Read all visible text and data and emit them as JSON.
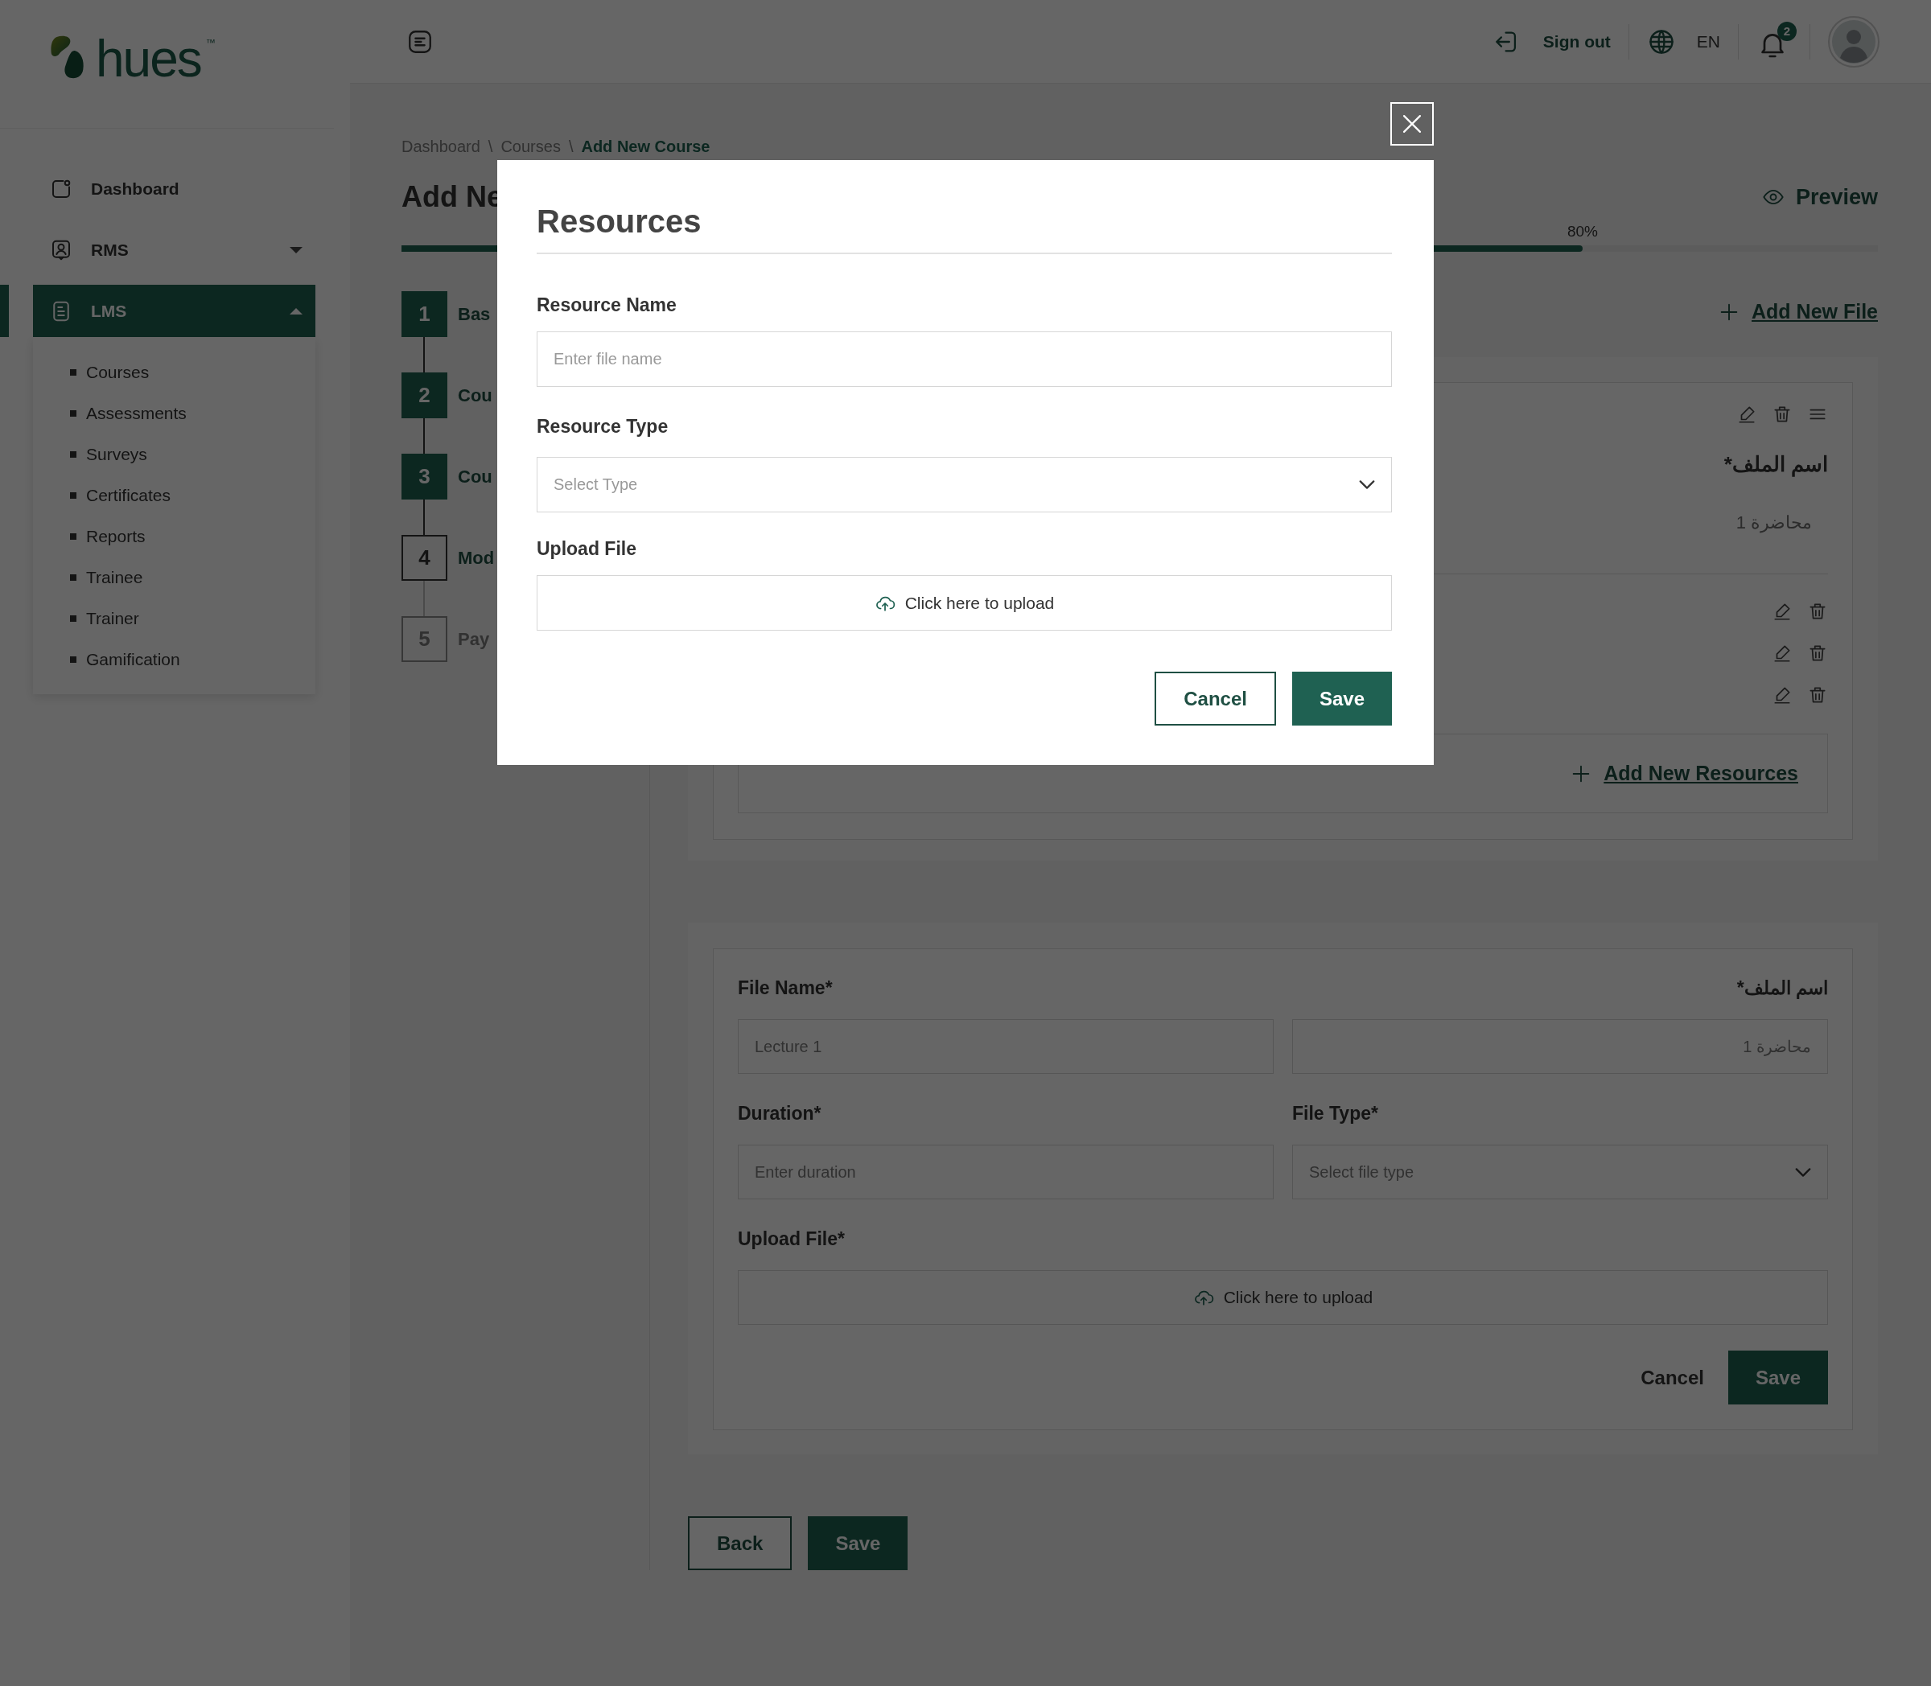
{
  "sidebar": {
    "logo": {
      "text": "hues",
      "trademark": "™"
    },
    "items": [
      {
        "kind": "link",
        "label": "Dashboard",
        "selected": false
      },
      {
        "kind": "group",
        "label": "RMS",
        "selected": false,
        "expanded": false
      },
      {
        "kind": "group",
        "label": "LMS",
        "selected": true,
        "expanded": true,
        "children": [
          {
            "label": "Courses",
            "selected": false
          },
          {
            "label": "Assessments",
            "selected": false
          },
          {
            "label": "Surveys",
            "selected": false
          },
          {
            "label": "Certificates",
            "selected": false
          },
          {
            "label": "Reports",
            "selected": false
          },
          {
            "label": "Trainee",
            "selected": false
          },
          {
            "label": "Trainer",
            "selected": false
          },
          {
            "label": "Gamification",
            "selected": false
          }
        ]
      }
    ]
  },
  "header": {
    "sign_out": "Sign out",
    "language": "EN",
    "notifications": "2"
  },
  "breadcrumb": {
    "separator": "\\",
    "items": [
      {
        "label": "Dashboard",
        "current": false
      },
      {
        "label": "Courses",
        "current": false
      },
      {
        "label": "Add New Course",
        "current": true
      }
    ]
  },
  "page_title": "Add Ne",
  "preview": "Preview",
  "progress": {
    "level": 0.8,
    "reading": "80%"
  },
  "steps": [
    {
      "number": "1",
      "label": "Bas",
      "done": true,
      "active": false
    },
    {
      "number": "2",
      "label": "Cou",
      "done": true,
      "active": false
    },
    {
      "number": "3",
      "label": "Cou",
      "done": true,
      "active": false
    },
    {
      "number": "4",
      "label": "Mod",
      "done": false,
      "active": true
    },
    {
      "number": "5",
      "label": "Pay",
      "done": false,
      "active": false
    }
  ],
  "add_file": "Add New File",
  "file_cards": [
    {
      "kind": "summary",
      "actions": [
        {
          "kind": "edit"
        },
        {
          "kind": "delete"
        },
        {
          "kind": "drag"
        }
      ],
      "label": "اسم الملف*",
      "value": "محاضرة 1",
      "resources": [
        {
          "actions": [
            {
              "kind": "edit"
            },
            {
              "kind": "delete"
            }
          ]
        },
        {
          "actions": [
            {
              "kind": "edit"
            },
            {
              "kind": "delete"
            }
          ]
        },
        {
          "actions": [
            {
              "kind": "edit"
            },
            {
              "kind": "delete"
            }
          ]
        }
      ],
      "add_resources": "Add New Resources"
    },
    {
      "kind": "form",
      "fields": [
        {
          "kind": "text",
          "label": "File Name*",
          "placeholder": "Lecture 1"
        },
        {
          "kind": "text_rtl",
          "label": "اسم الملف*",
          "placeholder": "محاضرة 1"
        },
        {
          "kind": "text",
          "label": "Duration*",
          "placeholder": "Enter duration"
        },
        {
          "kind": "select",
          "label": "File Type*",
          "placeholder": "Select file type"
        },
        {
          "kind": "upload",
          "label": "Upload File*",
          "text": "Click here to upload"
        }
      ],
      "buttons": [
        {
          "kind": "text",
          "label": "Cancel"
        },
        {
          "kind": "primary",
          "label": "Save"
        }
      ]
    }
  ],
  "footer_buttons": [
    {
      "kind": "secondary",
      "label": "Back"
    },
    {
      "kind": "primary",
      "label": "Save"
    }
  ],
  "modal": {
    "title": "Resources",
    "fields": [
      {
        "kind": "text",
        "label": "Resource Name",
        "placeholder": "Enter file name"
      },
      {
        "kind": "select",
        "label": "Resource Type",
        "placeholder": "Select Type"
      },
      {
        "kind": "upload",
        "label": "Upload File",
        "text": "Click here to upload"
      }
    ],
    "buttons": [
      {
        "kind": "secondary",
        "label": "Cancel"
      },
      {
        "kind": "primary",
        "label": "Save"
      }
    ]
  }
}
